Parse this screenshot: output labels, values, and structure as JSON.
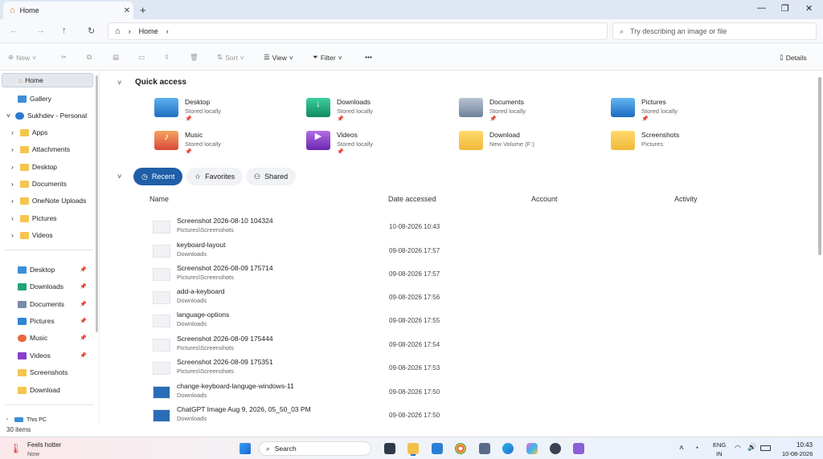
{
  "window": {
    "tab_title": "Home",
    "new_tab": "+"
  },
  "nav": {
    "breadcrumb": "Home",
    "search_placeholder": "Try describing an image or file"
  },
  "toolbar": {
    "new": "New",
    "sort": "Sort",
    "view": "View",
    "filter": "Filter",
    "more": "•••",
    "details": "Details"
  },
  "sidebar": {
    "home": "Home",
    "gallery": "Gallery",
    "account": "Sukhdev - Personal",
    "folders": [
      "Apps",
      "Attachments",
      "Desktop",
      "Documents",
      "OneNote Uploads",
      "Pictures",
      "Videos"
    ],
    "pinned": [
      "Desktop",
      "Downloads",
      "Documents",
      "Pictures",
      "Music",
      "Videos",
      "Screenshots",
      "Download"
    ],
    "this_pc": "This PC"
  },
  "quick_access": {
    "title": "Quick access",
    "items": [
      {
        "name": "Desktop",
        "sub": "Stored locally"
      },
      {
        "name": "Downloads",
        "sub": "Stored locally"
      },
      {
        "name": "Documents",
        "sub": "Stored locally"
      },
      {
        "name": "Pictures",
        "sub": "Stored locally"
      },
      {
        "name": "Music",
        "sub": "Stored locally"
      },
      {
        "name": "Videos",
        "sub": "Stored locally"
      },
      {
        "name": "Download",
        "sub": "New Volume (F:)"
      },
      {
        "name": "Screenshots",
        "sub": "Pictures"
      }
    ]
  },
  "filters": {
    "recent": "Recent",
    "favorites": "Favorites",
    "shared": "Shared"
  },
  "columns": {
    "name": "Name",
    "date": "Date accessed",
    "account": "Account",
    "activity": "Activity"
  },
  "files": [
    {
      "name": "Screenshot 2026-08-10 104324",
      "path": "Pictures\\Screenshots",
      "date": "10-08-2026 10:43"
    },
    {
      "name": "keyboard-layout",
      "path": "Downloads",
      "date": "09-08-2026 17:57"
    },
    {
      "name": "Screenshot 2026-08-09 175714",
      "path": "Pictures\\Screenshots",
      "date": "09-08-2026 17:57"
    },
    {
      "name": "add-a-keyboard",
      "path": "Downloads",
      "date": "09-08-2026 17:56"
    },
    {
      "name": "language-options",
      "path": "Downloads",
      "date": "09-08-2026 17:55"
    },
    {
      "name": "Screenshot 2026-08-09 175444",
      "path": "Pictures\\Screenshots",
      "date": "09-08-2026 17:54"
    },
    {
      "name": "Screenshot 2026-08-09 175351",
      "path": "Pictures\\Screenshots",
      "date": "09-08-2026 17:53"
    },
    {
      "name": "change-keyboard-languge-windows-11",
      "path": "Downloads",
      "date": "09-08-2026 17:50"
    },
    {
      "name": "ChatGPT Image Aug 9, 2026, 05_50_03 PM",
      "path": "Downloads",
      "date": "09-08-2026 17:50"
    }
  ],
  "status": {
    "items": "30 items"
  },
  "taskbar": {
    "weather_title": "Feels hotter",
    "weather_sub": "Now",
    "search": "Search",
    "lang": "ENG",
    "region": "IN",
    "time": "10:43",
    "date": "10-08-2026"
  }
}
